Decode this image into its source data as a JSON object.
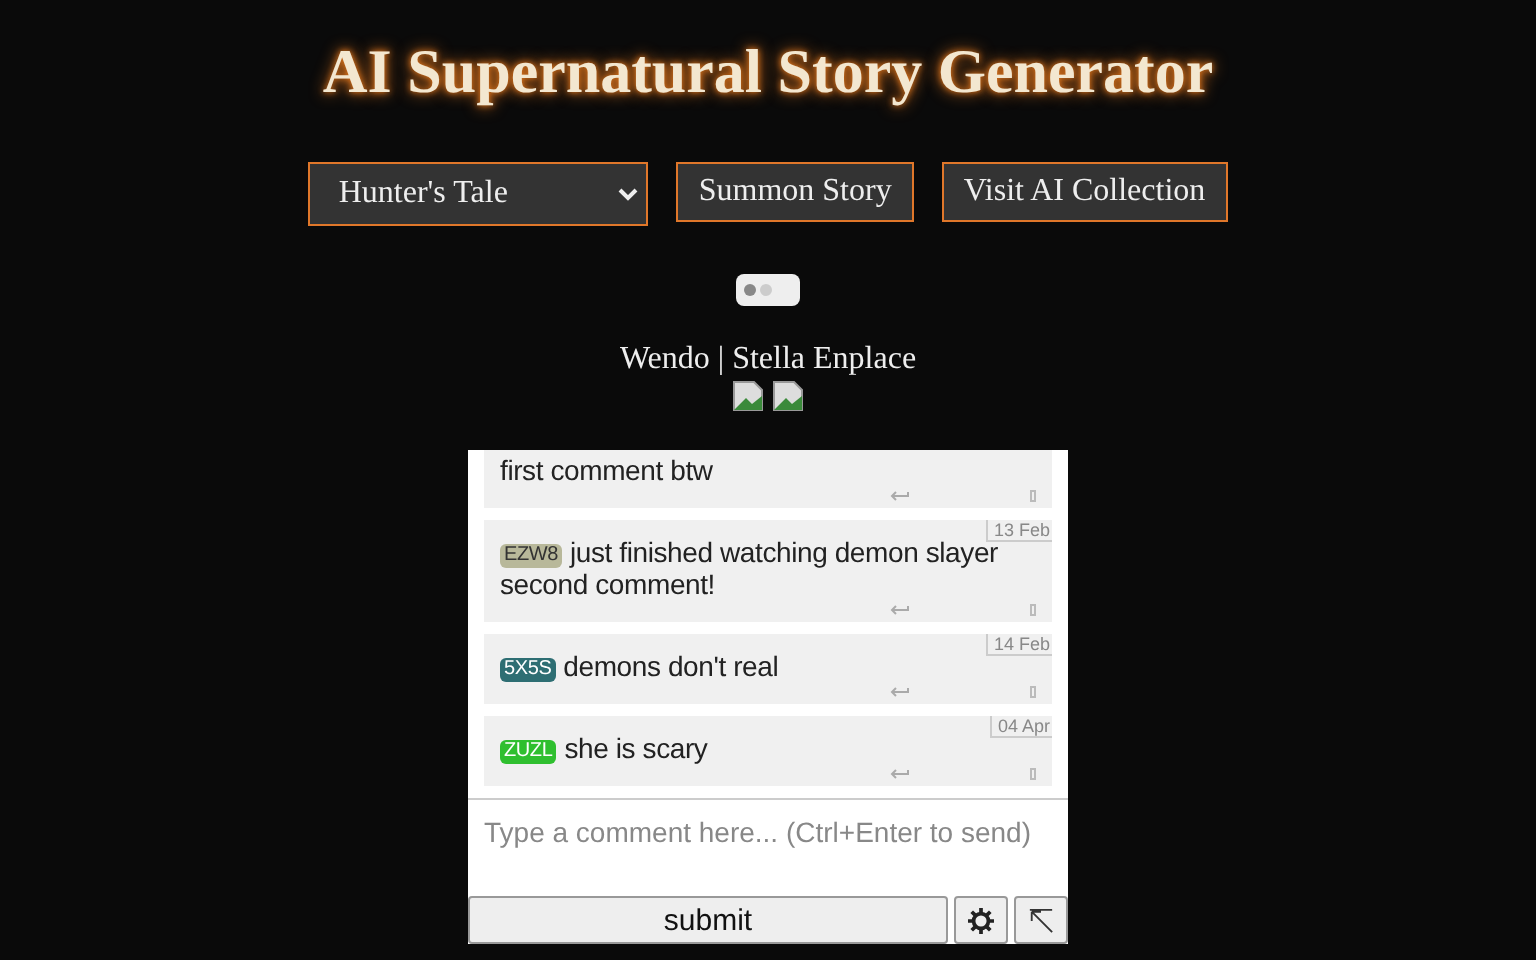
{
  "title": "AI Supernatural Story Generator",
  "controls": {
    "story_select": "Hunter's Tale",
    "buttons": [
      "Summon Story",
      "Visit AI Collection"
    ]
  },
  "toggle": {
    "on": false
  },
  "credits": "Wendo | Stella Enplace",
  "comments": [
    {
      "text": "first comment btw"
    },
    {
      "tag": "EZW8",
      "color": "#b8b89a",
      "date": "13 Feb",
      "text": "just finished watching demon slayer second comment!"
    },
    {
      "tag": "5X5S",
      "color": "#2e6e73",
      "date": "14 Feb",
      "text": "demons don't real"
    },
    {
      "tag": "ZUZL",
      "color": "#2fbf2f",
      "date": "04 Apr",
      "text": "she is scary"
    }
  ],
  "composer": {
    "placeholder": "Type a comment here... (Ctrl+Enter to send)",
    "submit": "submit"
  }
}
